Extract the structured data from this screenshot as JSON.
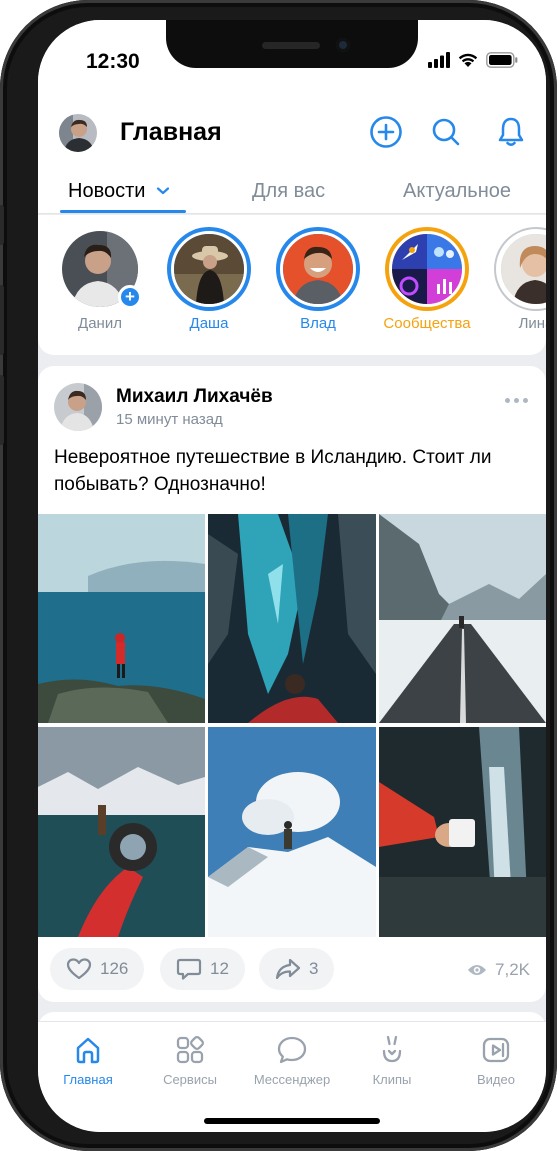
{
  "status": {
    "time": "12:30"
  },
  "header": {
    "title": "Главная"
  },
  "tabs": [
    {
      "label": "Новости",
      "active": true
    },
    {
      "label": "Для вас",
      "active": false
    },
    {
      "label": "Актуальное",
      "active": false
    }
  ],
  "stories": [
    {
      "name": "Данил",
      "style": "own"
    },
    {
      "name": "Даша",
      "style": "unseen"
    },
    {
      "name": "Влад",
      "style": "unseen"
    },
    {
      "name": "Сообщества",
      "style": "communities"
    },
    {
      "name": "Лина",
      "style": "seen"
    }
  ],
  "post": {
    "author": "Михаил Лихачёв",
    "time": "15 минут назад",
    "text": "Невероятное путешествие в Исландию. Стоит ли побывать? Однозначно!",
    "likes": "126",
    "comments": "12",
    "shares": "3",
    "views": "7,2K"
  },
  "tabbar": [
    {
      "label": "Главная",
      "icon": "home-icon",
      "active": true
    },
    {
      "label": "Сервисы",
      "icon": "services-icon",
      "active": false
    },
    {
      "label": "Мессенджер",
      "icon": "messenger-icon",
      "active": false
    },
    {
      "label": "Клипы",
      "icon": "clips-icon",
      "active": false
    },
    {
      "label": "Видео",
      "icon": "video-icon",
      "active": false
    }
  ],
  "colors": {
    "accent": "#2688eb",
    "communities": "#f5a20f",
    "text_secondary": "#818c99"
  }
}
